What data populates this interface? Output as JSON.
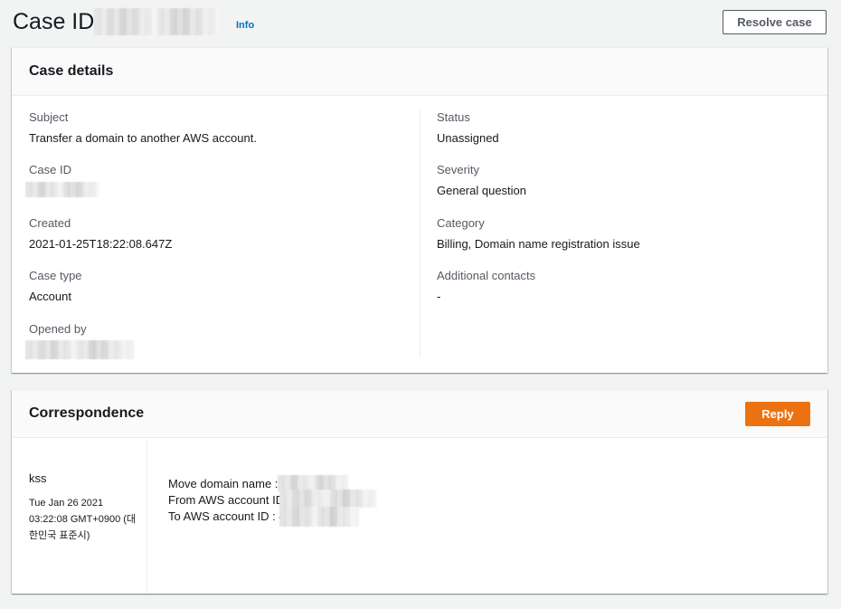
{
  "header": {
    "title": "Case ID",
    "info_label": "Info",
    "resolve_label": "Resolve case"
  },
  "details": {
    "title": "Case details",
    "left": [
      {
        "label": "Subject",
        "value": "Transfer a domain to another AWS account."
      },
      {
        "label": "Case ID",
        "value": ""
      },
      {
        "label": "Created",
        "value": "2021-01-25T18:22:08.647Z"
      },
      {
        "label": "Case type",
        "value": "Account"
      },
      {
        "label": "Opened by",
        "value": ""
      }
    ],
    "right": [
      {
        "label": "Status",
        "value": "Unassigned"
      },
      {
        "label": "Severity",
        "value": "General question"
      },
      {
        "label": "Category",
        "value": "Billing, Domain name registration issue"
      },
      {
        "label": "Additional contacts",
        "value": "-"
      }
    ]
  },
  "correspondence": {
    "title": "Correspondence",
    "reply_label": "Reply",
    "author": "kss",
    "timestamp_line1": "Tue Jan 26 2021",
    "timestamp_line2": "03:22:08 GMT+0900 (대한민국 표준시)",
    "message_lines": [
      "Move domain name :",
      "From AWS account ID",
      "To AWS account ID : 4"
    ]
  },
  "colors": {
    "accent": "#ec7211",
    "link": "#0073bb",
    "background": "#f2f3f3"
  }
}
